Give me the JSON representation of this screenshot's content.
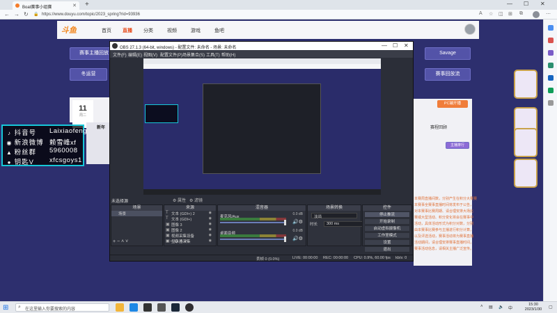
{
  "browser": {
    "tab_title": "Boat赛事小组赛",
    "new_tab": "+",
    "url": "https://www.douyu.com/topic/2023_spring?rid=93936",
    "controls": {
      "minimize": "—",
      "maximize": "☐",
      "close": "✕"
    }
  },
  "site": {
    "logo": "斗鱼",
    "nav": [
      "首页",
      "直播",
      "分类",
      "视频",
      "游戏",
      "鱼吧"
    ],
    "active_nav": "直播",
    "pills": {
      "schedule": "赛事主播回放",
      "savage": "Savage",
      "group_stage": "冬运营",
      "event_flow": "赛事回放流"
    },
    "date": {
      "day": "11",
      "sub": "周二"
    },
    "new_label": "新年",
    "right_texts": [
      "本赛周直播间数，分别产生在积分大赛赛",
      "本赛事全赛事直播时间将发布于公告，",
      "对本赛事比赛周期、请合理安排大场比",
      "赛或大型活动、积分变化将会在赛事中",
      "活动，具体活动形式为积分对数，分别",
      "由本赛事比赛参与主播进行积分计算，",
      "以及评选活动，赛事活动将为赛事直播",
      "活动期间，请合理安排赛事直播时间，",
      "赛事活动信息，请相关主播广泛宣传。"
    ],
    "pc_label": "PC端开播",
    "live_label": "赛程回顾",
    "rank_label": "主播排行"
  },
  "overlay_info": [
    {
      "icon": "♪",
      "key": "抖音号",
      "value": "Laixiaofeng"
    },
    {
      "icon": "◉",
      "key": "新浪微博",
      "value": "赖雪峰xf"
    },
    {
      "icon": "▲",
      "key": "粉丝群",
      "value": "5960008"
    },
    {
      "icon": "●",
      "key": "钥匙V",
      "value": "xfcsgoys1"
    }
  ],
  "obs": {
    "title": "OBS 27.1.3 (64-bit, windows) - 配置文件: 未命名 - 场景: 未命名",
    "menu": [
      "文件(F)",
      "编辑(E)",
      "视图(V)",
      "配置文件(P)",
      "场景集合(S)",
      "工具(T)",
      "帮助(H)"
    ],
    "scene_label": "未选择源",
    "preview_controls": [
      "⚙ 属性",
      "⚙ 滤镜"
    ],
    "docks": {
      "scenes": "场景",
      "sources": "来源",
      "mixer": "混音器",
      "transitions": "场景转换",
      "controls": "控件"
    },
    "scenes_list": [
      "场景"
    ],
    "sources_list": [
      {
        "icon": "T",
        "name": "文本 (GDI+) 2"
      },
      {
        "icon": "T",
        "name": "文本 (GDI+)"
      },
      {
        "icon": "▣",
        "name": "图像 3"
      },
      {
        "icon": "▣",
        "name": "图像 2"
      },
      {
        "icon": "▣",
        "name": "视频采集设备"
      },
      {
        "icon": "▣",
        "name": "显示器采集"
      }
    ],
    "mixer": [
      {
        "name": "麦克风/Aux",
        "db": "0.0 dB"
      },
      {
        "name": "桌面音频",
        "db": "0.0 dB"
      }
    ],
    "transition": {
      "type": "淡出",
      "duration_label": "时长",
      "duration": "300 ms"
    },
    "controls": [
      "停止推流",
      "开始录制",
      "启动虚拟摄像机",
      "工作室模式",
      "设置",
      "退出"
    ],
    "status": {
      "dropped": "丢帧 0 (0.0%)",
      "live": "LIVE: 00:00:00",
      "rec": "REC: 00:00:00",
      "cpu": "CPU: 0.9%, 60.00 fps",
      "kbps": "kb/s: 0"
    }
  },
  "taskbar": {
    "search_placeholder": "在这里输入你要搜索的内容",
    "time": "15:30",
    "date": "2023/1/30",
    "lang": "中",
    "temp": "6°C 晴"
  }
}
